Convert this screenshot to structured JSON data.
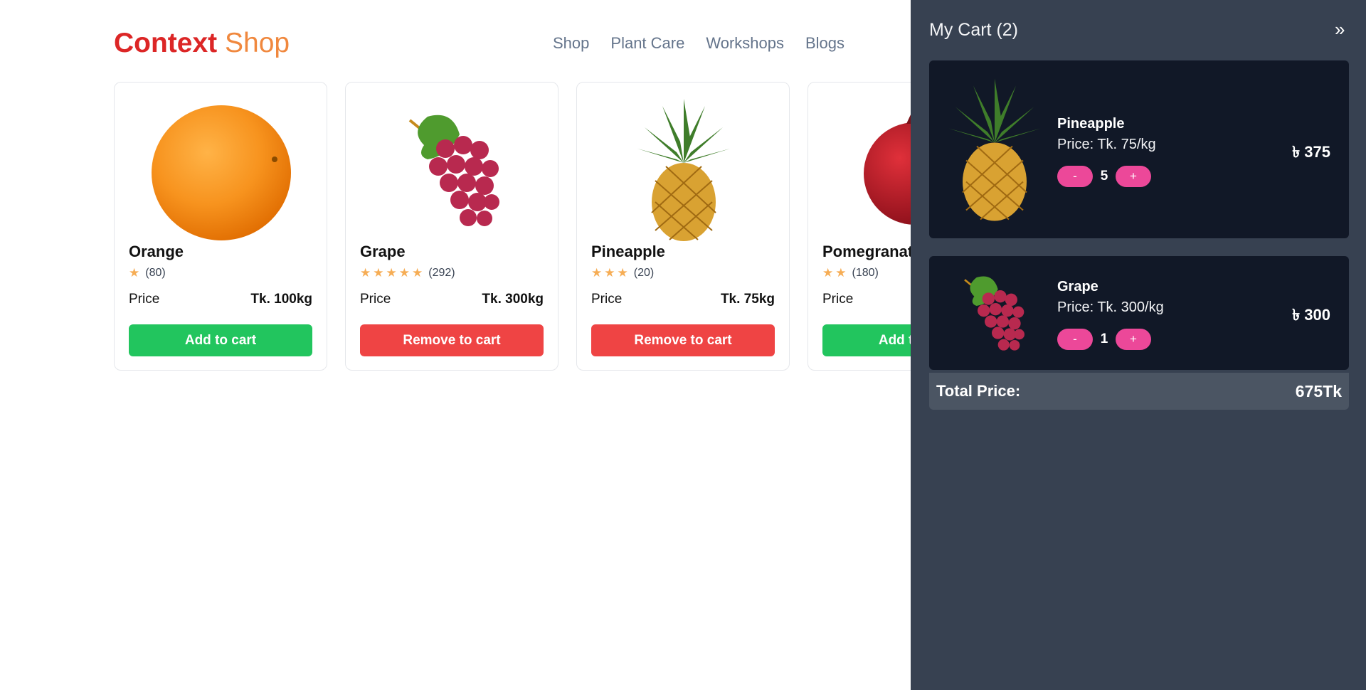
{
  "logo": {
    "brand": "Context",
    "accent": "Shop"
  },
  "nav": {
    "items": [
      "Shop",
      "Plant Care",
      "Workshops",
      "Blogs"
    ]
  },
  "products": [
    {
      "name": "Orange",
      "stars": 1,
      "reviews": "(80)",
      "price_label": "Price",
      "price": "Tk. 100kg",
      "button": "Add to cart",
      "in_cart": false,
      "image": "orange-image"
    },
    {
      "name": "Grape",
      "stars": 5,
      "reviews": "(292)",
      "price_label": "Price",
      "price": "Tk. 300kg",
      "button": "Remove to cart",
      "in_cart": true,
      "image": "grape-image"
    },
    {
      "name": "Pineapple",
      "stars": 3,
      "reviews": "(20)",
      "price_label": "Price",
      "price": "Tk. 75kg",
      "button": "Remove to cart",
      "in_cart": true,
      "image": "pineapple-image"
    },
    {
      "name": "Pomegranate",
      "stars": 2,
      "reviews": "(180)",
      "price_label": "Price",
      "price": "",
      "button": "Add to cart",
      "in_cart": false,
      "image": "pomegranate-image"
    }
  ],
  "cart": {
    "title": "My Cart (2)",
    "close_icon": "double-chevron-right-icon",
    "items": [
      {
        "name": "Pineapple",
        "unit_price": "Price: Tk. 75/kg",
        "decrement": "-",
        "quantity": "5",
        "increment": "+",
        "line_total": "৳ 375",
        "image": "pineapple-image"
      },
      {
        "name": "Grape",
        "unit_price": "Price: Tk. 300/kg",
        "decrement": "-",
        "quantity": "1",
        "increment": "+",
        "line_total": "৳ 300",
        "image": "grape-image"
      }
    ],
    "total_label": "Total Price:",
    "total_value": "675Tk"
  },
  "colors": {
    "brand_red": "#dc2626",
    "brand_orange": "#f0883e",
    "add_button": "#22c55e",
    "remove_button": "#ef4444",
    "drawer_bg": "#374151",
    "cart_item_bg": "#111827",
    "qty_button": "#ec4899",
    "star": "#f6ad55"
  }
}
